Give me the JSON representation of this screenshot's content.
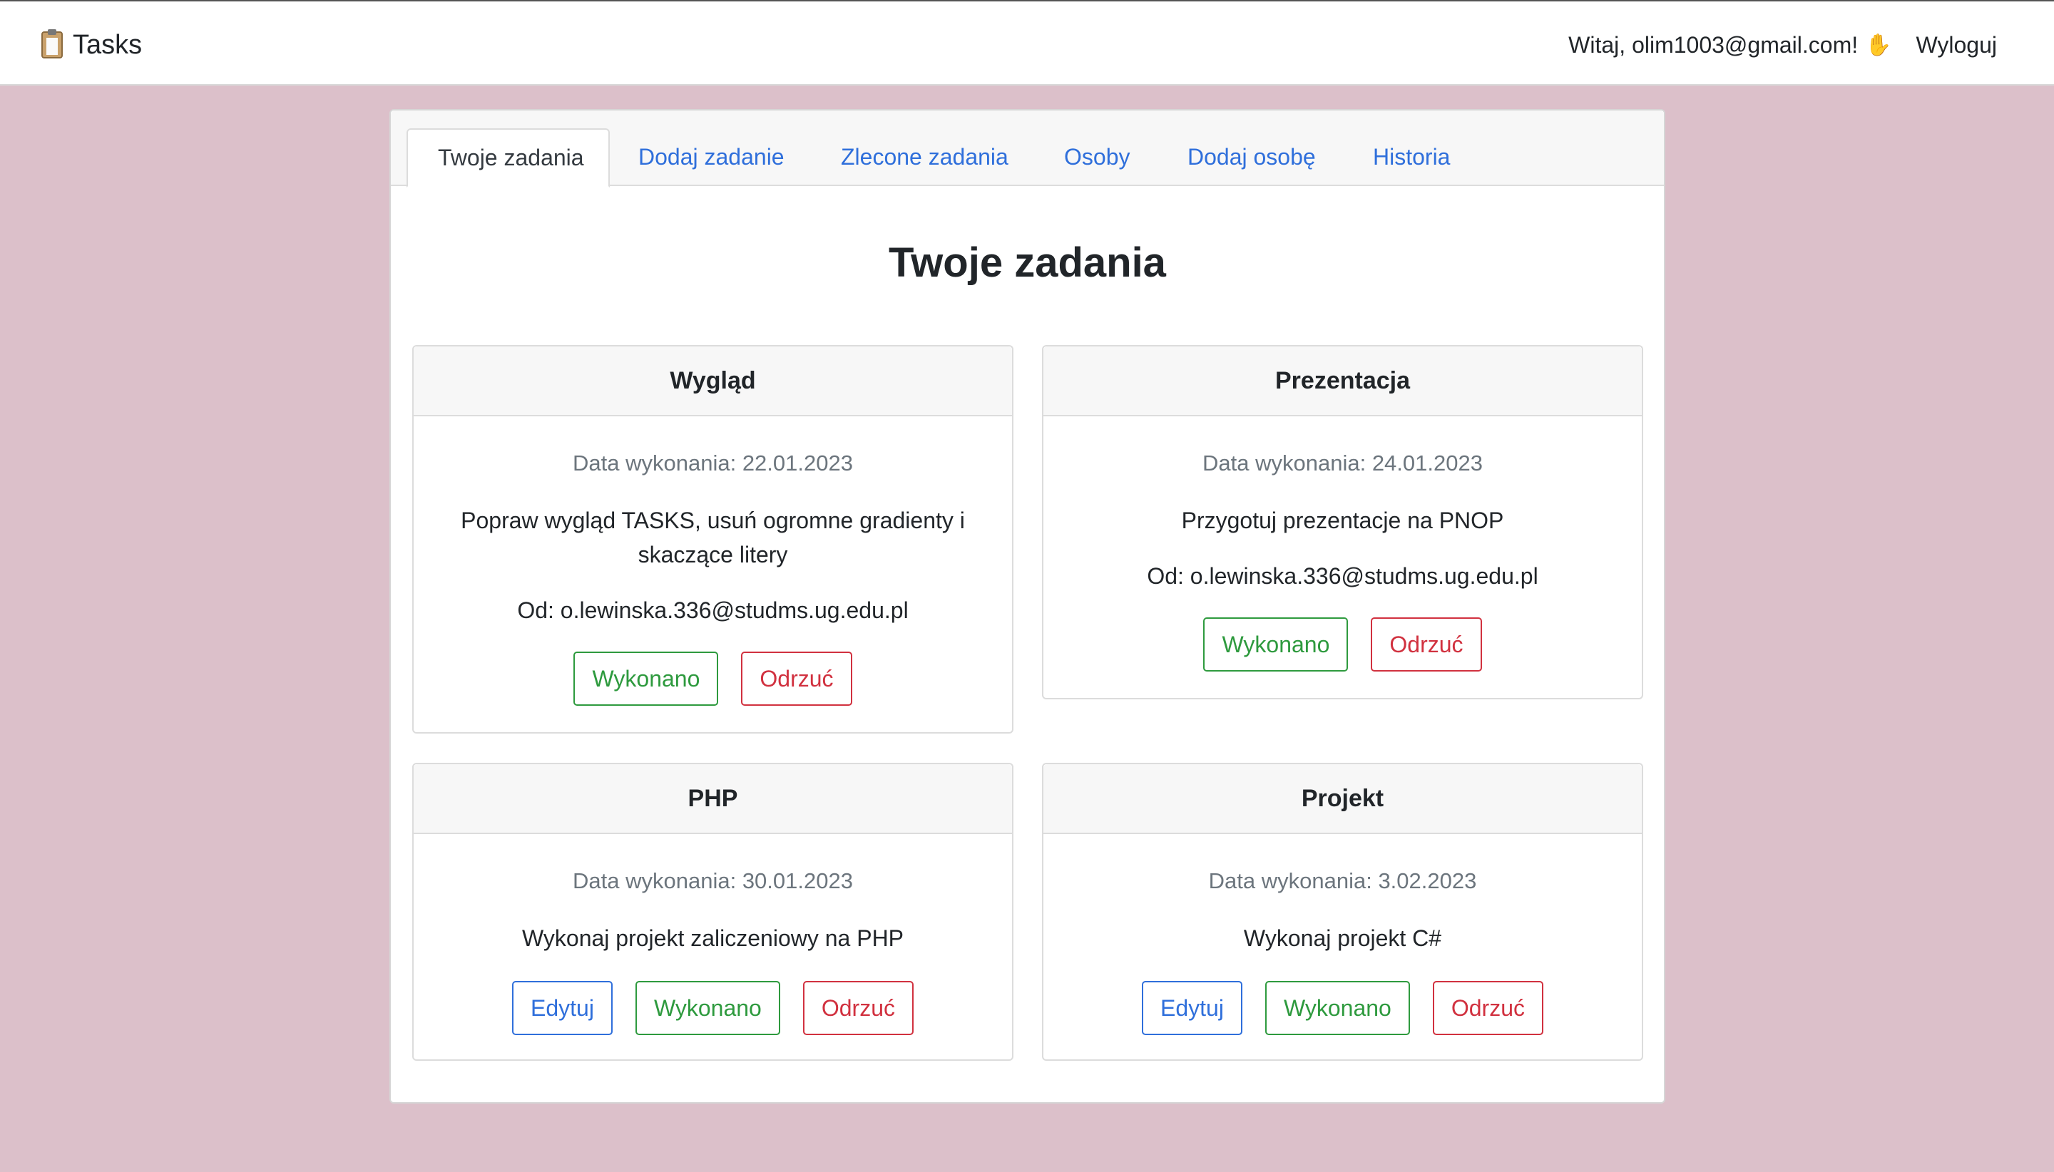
{
  "navbar": {
    "brand": "Tasks",
    "brand_icon": "clipboard-icon",
    "greeting": "Witaj, olim1003@gmail.com!",
    "greeting_icon": "waving-hand-icon",
    "logout": "Wyloguj"
  },
  "tabs": [
    {
      "label": "Twoje zadania",
      "active": true
    },
    {
      "label": "Dodaj zadanie",
      "active": false
    },
    {
      "label": "Zlecone zadania",
      "active": false
    },
    {
      "label": "Osoby",
      "active": false
    },
    {
      "label": "Dodaj osobę",
      "active": false
    },
    {
      "label": "Historia",
      "active": false
    }
  ],
  "page_title": "Twoje zadania",
  "tasks": [
    {
      "title": "Wygląd",
      "due": "Data wykonania: 22.01.2023",
      "description": "Popraw wygląd TASKS, usuń ogromne gradienty i skaczące litery",
      "from": "Od: o.lewinska.336@studms.ug.edu.pl",
      "done_label": "Wykonano",
      "reject_label": "Odrzuć"
    },
    {
      "title": "Prezentacja",
      "due": "Data wykonania: 24.01.2023",
      "description": "Przygotuj prezentacje na PNOP",
      "from": "Od: o.lewinska.336@studms.ug.edu.pl",
      "done_label": "Wykonano",
      "reject_label": "Odrzuć"
    },
    {
      "title": "PHP",
      "due": "Data wykonania: 30.01.2023",
      "description": "Wykonaj projekt zaliczeniowy na PHP",
      "edit_label": "Edytuj",
      "done_label": "Wykonano",
      "reject_label": "Odrzuć"
    },
    {
      "title": "Projekt",
      "due": "Data wykonania: 3.02.2023",
      "description": "Wykonaj projekt C#",
      "edit_label": "Edytuj",
      "done_label": "Wykonano",
      "reject_label": "Odrzuć"
    }
  ],
  "colors": {
    "background": "#dcc0ca",
    "link": "#2f6fdb",
    "success": "#2e9a3e",
    "danger": "#d1313f"
  }
}
